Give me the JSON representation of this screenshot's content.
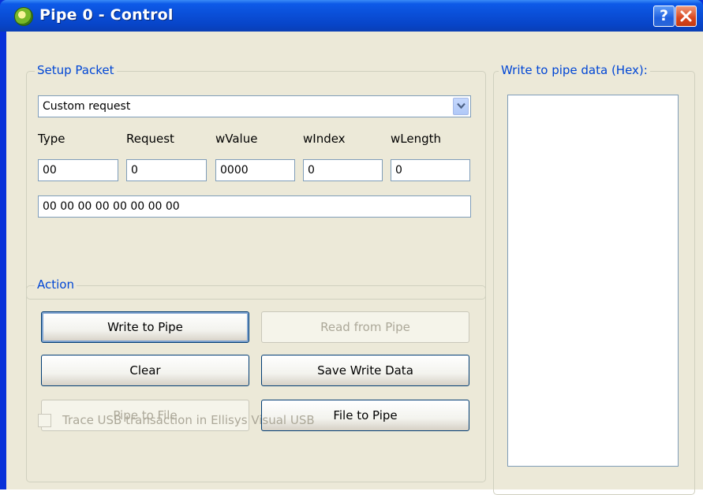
{
  "window": {
    "title": "Pipe 0 - Control",
    "help_label": "?",
    "close_label": "✕"
  },
  "setup_packet": {
    "legend": "Setup Packet",
    "request_select": "Custom request",
    "labels": {
      "type": "Type",
      "request": "Request",
      "wvalue": "wValue",
      "windex": "wIndex",
      "wlength": "wLength"
    },
    "values": {
      "type": "00",
      "request": "0",
      "wvalue": "0000",
      "windex": "0",
      "wlength": "0"
    },
    "raw_bytes": "00 00 00 00 00 00 00 00"
  },
  "action": {
    "legend": "Action",
    "write_to_pipe": "Write to Pipe",
    "read_from_pipe": "Read from Pipe",
    "clear": "Clear",
    "save_write_data": "Save Write Data",
    "pipe_to_file": "Pipe to File",
    "file_to_pipe": "File to Pipe",
    "trace_label": "Trace USB transaction in Ellisys Visual USB",
    "trace_checked": false
  },
  "write_data": {
    "legend": "Write to pipe data (Hex):",
    "content": ""
  },
  "colors": {
    "title_bar": "#0a4fd8",
    "client_bg": "#ece9d8",
    "legend_text": "#0046d5",
    "disabled_text": "#aca899"
  }
}
